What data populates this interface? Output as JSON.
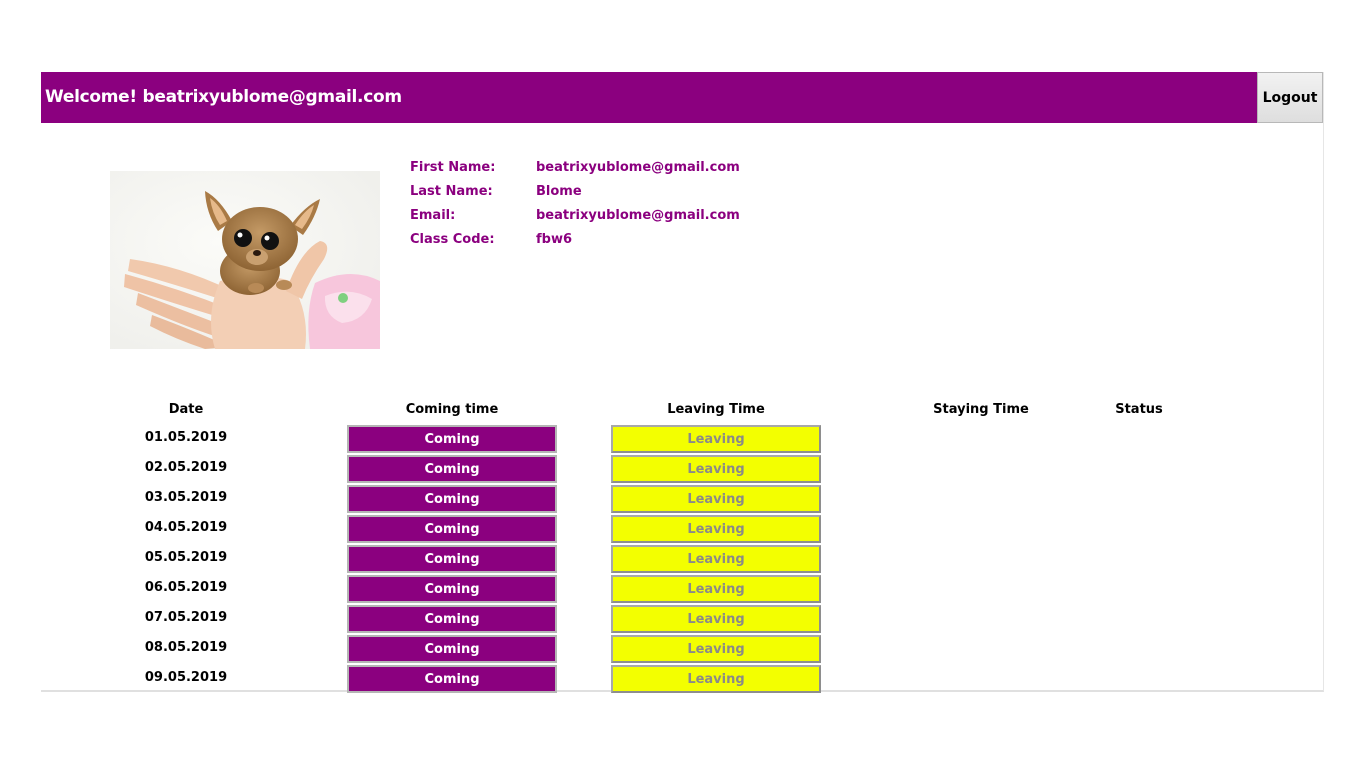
{
  "header": {
    "welcome_text": "Welcome! beatrixyublome@gmail.com",
    "logout_label": "Logout",
    "brand_color": "#8b007f"
  },
  "profile": {
    "photo_alt": "chihuahua puppy in hand",
    "fields": [
      {
        "label": "First Name:",
        "value": "beatrixyublome@gmail.com"
      },
      {
        "label": "Last Name:",
        "value": "Blome"
      },
      {
        "label": "Email:",
        "value": "beatrixyublome@gmail.com"
      },
      {
        "label": "Class Code:",
        "value": "fbw6"
      }
    ]
  },
  "table": {
    "headers": {
      "date": "Date",
      "coming": "Coming time",
      "leaving": "Leaving Time",
      "staying": "Staying Time",
      "status": "Status"
    },
    "coming_label": "Coming",
    "leaving_label": "Leaving",
    "coming_color": "#8b007f",
    "leaving_color": "#f3ff00",
    "rows": [
      {
        "date": "01.05.2019"
      },
      {
        "date": "02.05.2019"
      },
      {
        "date": "03.05.2019"
      },
      {
        "date": "04.05.2019"
      },
      {
        "date": "05.05.2019"
      },
      {
        "date": "06.05.2019"
      },
      {
        "date": "07.05.2019"
      },
      {
        "date": "08.05.2019"
      },
      {
        "date": "09.05.2019"
      }
    ]
  }
}
